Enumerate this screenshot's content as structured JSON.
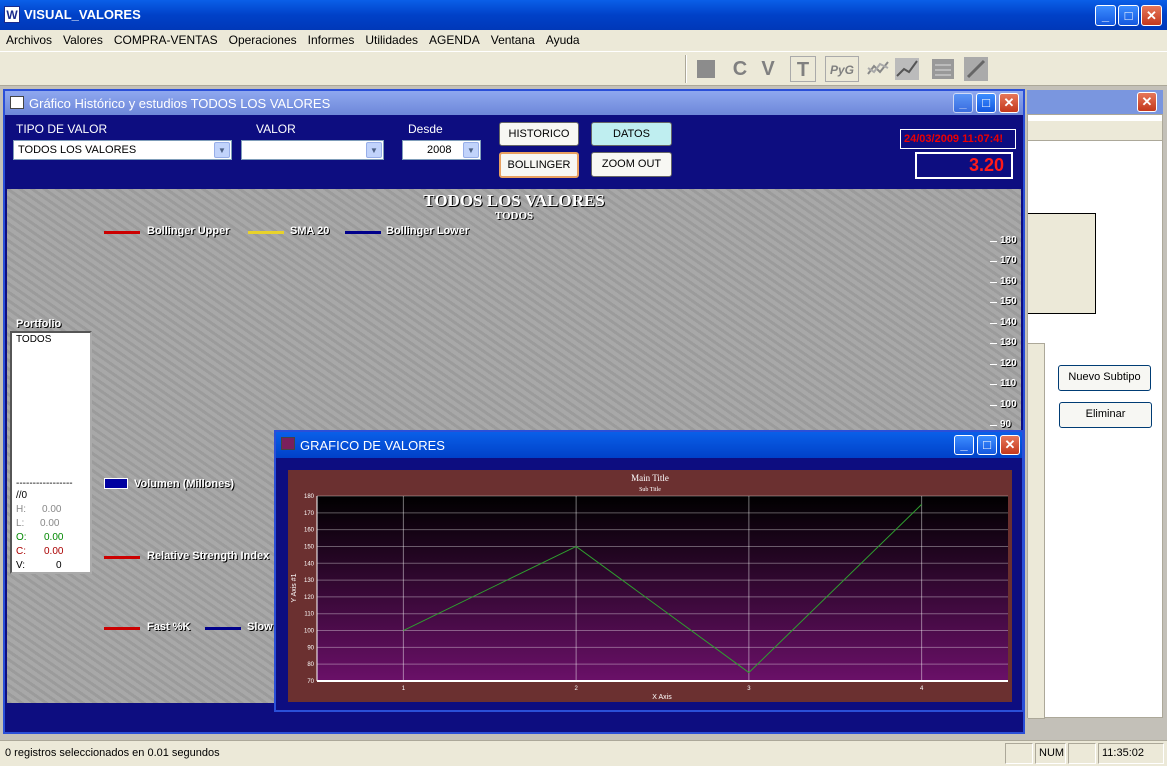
{
  "app": {
    "title": "VISUAL_VALORES",
    "logo": "W"
  },
  "menu": [
    "Archivos",
    "Valores",
    "COMPRA-VENTAS",
    "Operaciones",
    "Informes",
    "Utilidades",
    "AGENDA",
    "Ventana",
    "Ayuda"
  ],
  "toolbar": {
    "icons": [
      "square-icon",
      "c-icon",
      "v-icon",
      "t-icon",
      "pyg-icon",
      "chart-lines-icon",
      "chart-up-icon",
      "report-icon",
      "tools-icon"
    ],
    "c": "C",
    "v": "V",
    "t": "T",
    "pyg": "PyG"
  },
  "bgwin": {
    "nuevo_subtipo": "Nuevo Subtipo",
    "eliminar": "Eliminar"
  },
  "main": {
    "title": "Gráfico Histórico y estudios TODOS LOS VALORES",
    "tipo_label": "TIPO DE VALOR",
    "tipo_value": "TODOS LOS VALORES",
    "valor_label": "VALOR",
    "valor_value": "",
    "desde_label": "Desde",
    "desde_value": "2008",
    "btn_historico": "HISTORICO",
    "btn_datos": "DATOS",
    "btn_bollinger": "BOLLINGER",
    "btn_zoom": "ZOOM OUT",
    "datetime": "24/03/2009 11:07:4!",
    "price": "3.20",
    "chart_title": "TODOS LOS VALORES",
    "chart_subtitle": "TODOS",
    "legend": {
      "bu": "Bollinger Upper",
      "sma": "SMA 20",
      "bl": "Bollinger Lower",
      "vol": "Volumen (Millones)",
      "rsi": "Relative Strength Index",
      "fast": "Fast %K",
      "slow": "Slow"
    },
    "yticks": [
      "180",
      "170",
      "160",
      "150",
      "140",
      "130",
      "120",
      "110",
      "100",
      "90"
    ],
    "portfolio": {
      "label": "Portfolio",
      "item": "TODOS",
      "dashes": "-----------------",
      "date": "//0",
      "h": "H:",
      "hv": "0.00",
      "l": "L:",
      "lv": "0.00",
      "o": "O:",
      "ov": "0.00",
      "c": "C:",
      "cv": "0.00",
      "v": "V:",
      "vv": "0"
    },
    "colors": {
      "upper": "#cc0000",
      "sma": "#e8d22a",
      "lower": "#00008b",
      "volume": "#0000a0"
    }
  },
  "graph": {
    "title": "GRAFICO DE VALORES"
  },
  "chart_data": {
    "type": "line",
    "title": "Main Title",
    "subtitle": "Sub Title",
    "xlabel": "X Axis",
    "ylabel": "Y Axis #1",
    "x": [
      1,
      2,
      3,
      4
    ],
    "series": [
      {
        "values": [
          100,
          150,
          75,
          175
        ],
        "color": "#2f9f2f"
      }
    ],
    "ylim": [
      70,
      180
    ],
    "yticks": [
      70,
      80,
      90,
      100,
      110,
      120,
      130,
      140,
      150,
      160,
      170,
      180
    ],
    "grid": true
  },
  "status": {
    "text": "0 registros seleccionados en 0.01 segundos",
    "num": "NUM",
    "time": "11:35:02"
  }
}
